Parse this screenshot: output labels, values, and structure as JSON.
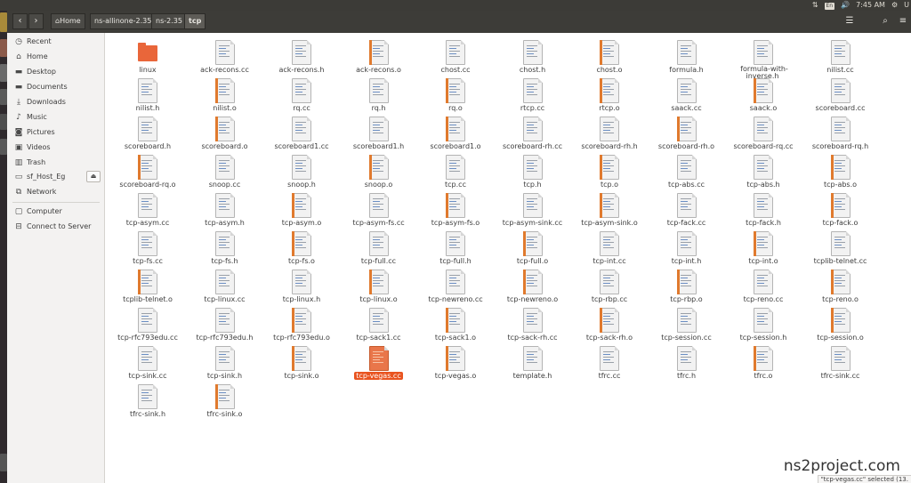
{
  "top_panel": {
    "keyboard_layout": "En",
    "clock": "7:45 AM",
    "user_initial": "U"
  },
  "header": {
    "back_label": "‹",
    "forward_label": "›",
    "breadcrumbs": [
      {
        "label": "Home",
        "icon": "home-icon"
      },
      {
        "label": "ns-allinone-2.35"
      },
      {
        "label": "ns-2.35"
      },
      {
        "label": "tcp"
      }
    ],
    "search_icon": "search-icon",
    "view_icon": "list-view-icon",
    "menu_icon": "hamburger-menu-icon"
  },
  "sidebar": {
    "items": [
      {
        "label": "Recent",
        "icon": "clock-icon"
      },
      {
        "label": "Home",
        "icon": "home-icon"
      },
      {
        "label": "Desktop",
        "icon": "folder-icon"
      },
      {
        "label": "Documents",
        "icon": "folder-icon"
      },
      {
        "label": "Downloads",
        "icon": "download-icon"
      },
      {
        "label": "Music",
        "icon": "music-icon"
      },
      {
        "label": "Pictures",
        "icon": "camera-icon"
      },
      {
        "label": "Videos",
        "icon": "film-icon"
      },
      {
        "label": "Trash",
        "icon": "trash-icon"
      },
      {
        "label": "sf_Host_Eg",
        "icon": "drive-icon"
      },
      {
        "label": "Network",
        "icon": "network-icon"
      },
      {
        "label": "Computer",
        "icon": "computer-icon"
      },
      {
        "label": "Connect to Server",
        "icon": "server-icon"
      }
    ]
  },
  "files": [
    {
      "name": "linux",
      "kind": "folder"
    },
    {
      "name": "ack-recons.cc",
      "kind": "cc"
    },
    {
      "name": "ack-recons.h",
      "kind": "h"
    },
    {
      "name": "ack-recons.o",
      "kind": "o"
    },
    {
      "name": "chost.cc",
      "kind": "cc"
    },
    {
      "name": "chost.h",
      "kind": "h"
    },
    {
      "name": "chost.o",
      "kind": "o"
    },
    {
      "name": "formula.h",
      "kind": "h"
    },
    {
      "name": "formula-with-inverse.h",
      "kind": "h"
    },
    {
      "name": "nilist.cc",
      "kind": "cc"
    },
    {
      "name": "nilist.h",
      "kind": "h"
    },
    {
      "name": "nilist.o",
      "kind": "o"
    },
    {
      "name": "rq.cc",
      "kind": "cc"
    },
    {
      "name": "rq.h",
      "kind": "h"
    },
    {
      "name": "rq.o",
      "kind": "o"
    },
    {
      "name": "rtcp.cc",
      "kind": "cc"
    },
    {
      "name": "rtcp.o",
      "kind": "o"
    },
    {
      "name": "saack.cc",
      "kind": "cc"
    },
    {
      "name": "saack.o",
      "kind": "o"
    },
    {
      "name": "scoreboard.cc",
      "kind": "cc"
    },
    {
      "name": "scoreboard.h",
      "kind": "h"
    },
    {
      "name": "scoreboard.o",
      "kind": "o"
    },
    {
      "name": "scoreboard1.cc",
      "kind": "cc"
    },
    {
      "name": "scoreboard1.h",
      "kind": "h"
    },
    {
      "name": "scoreboard1.o",
      "kind": "o"
    },
    {
      "name": "scoreboard-rh.cc",
      "kind": "cc"
    },
    {
      "name": "scoreboard-rh.h",
      "kind": "h"
    },
    {
      "name": "scoreboard-rh.o",
      "kind": "o"
    },
    {
      "name": "scoreboard-rq.cc",
      "kind": "cc"
    },
    {
      "name": "scoreboard-rq.h",
      "kind": "h"
    },
    {
      "name": "scoreboard-rq.o",
      "kind": "o"
    },
    {
      "name": "snoop.cc",
      "kind": "cc"
    },
    {
      "name": "snoop.h",
      "kind": "h"
    },
    {
      "name": "snoop.o",
      "kind": "o"
    },
    {
      "name": "tcp.cc",
      "kind": "cc"
    },
    {
      "name": "tcp.h",
      "kind": "h"
    },
    {
      "name": "tcp.o",
      "kind": "o"
    },
    {
      "name": "tcp-abs.cc",
      "kind": "cc"
    },
    {
      "name": "tcp-abs.h",
      "kind": "h"
    },
    {
      "name": "tcp-abs.o",
      "kind": "o"
    },
    {
      "name": "tcp-asym.cc",
      "kind": "cc"
    },
    {
      "name": "tcp-asym.h",
      "kind": "h"
    },
    {
      "name": "tcp-asym.o",
      "kind": "o"
    },
    {
      "name": "tcp-asym-fs.cc",
      "kind": "cc"
    },
    {
      "name": "tcp-asym-fs.o",
      "kind": "o"
    },
    {
      "name": "tcp-asym-sink.cc",
      "kind": "cc"
    },
    {
      "name": "tcp-asym-sink.o",
      "kind": "o"
    },
    {
      "name": "tcp-fack.cc",
      "kind": "cc"
    },
    {
      "name": "tcp-fack.h",
      "kind": "h"
    },
    {
      "name": "tcp-fack.o",
      "kind": "o"
    },
    {
      "name": "tcp-fs.cc",
      "kind": "cc"
    },
    {
      "name": "tcp-fs.h",
      "kind": "h"
    },
    {
      "name": "tcp-fs.o",
      "kind": "o"
    },
    {
      "name": "tcp-full.cc",
      "kind": "cc"
    },
    {
      "name": "tcp-full.h",
      "kind": "h"
    },
    {
      "name": "tcp-full.o",
      "kind": "o"
    },
    {
      "name": "tcp-int.cc",
      "kind": "cc"
    },
    {
      "name": "tcp-int.h",
      "kind": "h"
    },
    {
      "name": "tcp-int.o",
      "kind": "o"
    },
    {
      "name": "tcplib-telnet.cc",
      "kind": "cc"
    },
    {
      "name": "tcplib-telnet.o",
      "kind": "o"
    },
    {
      "name": "tcp-linux.cc",
      "kind": "cc"
    },
    {
      "name": "tcp-linux.h",
      "kind": "h"
    },
    {
      "name": "tcp-linux.o",
      "kind": "o"
    },
    {
      "name": "tcp-newreno.cc",
      "kind": "cc"
    },
    {
      "name": "tcp-newreno.o",
      "kind": "o"
    },
    {
      "name": "tcp-rbp.cc",
      "kind": "cc"
    },
    {
      "name": "tcp-rbp.o",
      "kind": "o"
    },
    {
      "name": "tcp-reno.cc",
      "kind": "cc"
    },
    {
      "name": "tcp-reno.o",
      "kind": "o"
    },
    {
      "name": "tcp-rfc793edu.cc",
      "kind": "cc"
    },
    {
      "name": "tcp-rfc793edu.h",
      "kind": "h"
    },
    {
      "name": "tcp-rfc793edu.o",
      "kind": "o"
    },
    {
      "name": "tcp-sack1.cc",
      "kind": "cc"
    },
    {
      "name": "tcp-sack1.o",
      "kind": "o"
    },
    {
      "name": "tcp-sack-rh.cc",
      "kind": "cc"
    },
    {
      "name": "tcp-sack-rh.o",
      "kind": "o"
    },
    {
      "name": "tcp-session.cc",
      "kind": "cc"
    },
    {
      "name": "tcp-session.h",
      "kind": "h"
    },
    {
      "name": "tcp-session.o",
      "kind": "o"
    },
    {
      "name": "tcp-sink.cc",
      "kind": "cc"
    },
    {
      "name": "tcp-sink.h",
      "kind": "h"
    },
    {
      "name": "tcp-sink.o",
      "kind": "o"
    },
    {
      "name": "tcp-vegas.cc",
      "kind": "cc",
      "selected": true
    },
    {
      "name": "tcp-vegas.o",
      "kind": "o"
    },
    {
      "name": "template.h",
      "kind": "h"
    },
    {
      "name": "tfrc.cc",
      "kind": "cc"
    },
    {
      "name": "tfrc.h",
      "kind": "h"
    },
    {
      "name": "tfrc.o",
      "kind": "o"
    },
    {
      "name": "tfrc-sink.cc",
      "kind": "cc"
    },
    {
      "name": "tfrc-sink.h",
      "kind": "h"
    },
    {
      "name": "tfrc-sink.o",
      "kind": "o"
    }
  ],
  "watermark": "ns2project.com",
  "status_bar": "\"tcp-vegas.cc\" selected  (13.",
  "colors": {
    "accent": "#e95420",
    "panel": "#3c3b37",
    "header": "#3d3c38",
    "sidebar": "#f3f2f1"
  }
}
